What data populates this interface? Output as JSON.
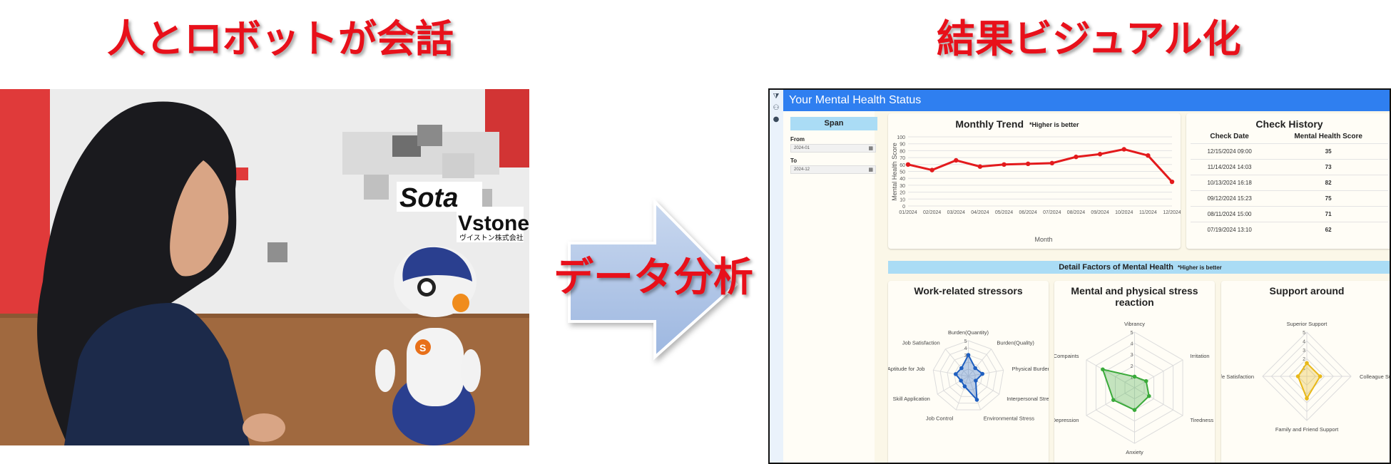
{
  "left_title": "人とロボットが会話",
  "right_title": "結果ビジュアル化",
  "arrow_label": "データ分析",
  "photo": {
    "sota_logo": "Sota",
    "vstone_logo": "Vstone",
    "vstone_sub": "ヴイストン株式会社"
  },
  "app": {
    "title": "Your Mental Health Status",
    "sidebar": {
      "span_label": "Span",
      "from_label": "From",
      "from_value": "2024-01",
      "to_label": "To",
      "to_value": "2024-12"
    },
    "monthly_trend": {
      "title": "Monthly Trend",
      "note": "*Higher is better",
      "ylabel": "Mental Health Score",
      "xlabel": "Month"
    },
    "check_history": {
      "title": "Check History",
      "col_date": "Check Date",
      "col_score": "Mental Health Score",
      "rows": [
        {
          "date": "12/15/2024 09:00",
          "score": "35"
        },
        {
          "date": "11/14/2024 14:03",
          "score": "73"
        },
        {
          "date": "10/13/2024 16:18",
          "score": "82"
        },
        {
          "date": "09/12/2024 15:23",
          "score": "75"
        },
        {
          "date": "08/11/2024 15:00",
          "score": "71"
        },
        {
          "date": "07/19/2024 13:10",
          "score": "62"
        }
      ]
    },
    "detail_title": "Detail Factors of Mental Health",
    "detail_note": "*Higher is better",
    "radar_titles": {
      "work": "Work-related stressors",
      "reaction": "Mental and physical stress reaction",
      "support": "Support around"
    }
  },
  "colors": {
    "title_red": "#e8101a",
    "header_blue": "#2f7ff0",
    "line_red": "#e31a1c",
    "radar_blue": "#1f5fc0",
    "radar_green": "#3aaa3a",
    "radar_yellow": "#e8b818"
  },
  "chart_data": [
    {
      "type": "line",
      "title": "Monthly Trend",
      "xlabel": "Month",
      "ylabel": "Mental Health Score",
      "ylim": [
        0,
        100
      ],
      "yticks": [
        "0",
        "10",
        "20",
        "30",
        "40",
        "50",
        "60",
        "70",
        "80",
        "90",
        "100"
      ],
      "categories": [
        "01/2024",
        "02/2024",
        "03/2024",
        "04/2024",
        "05/2024",
        "06/2024",
        "07/2024",
        "08/2024",
        "09/2024",
        "10/2024",
        "11/2024",
        "12/2024"
      ],
      "values": [
        60,
        52,
        66,
        57,
        60,
        61,
        62,
        71,
        75,
        82,
        73,
        35
      ],
      "grid": true
    },
    {
      "type": "radar",
      "title": "Work-related stressors",
      "axes": [
        "Burden(Quantity)",
        "Burden(Quality)",
        "Physical Burden",
        "Interpersonal Stress",
        "Environmental Stress",
        "Job Control",
        "Skill Application",
        "Aptitude for Job",
        "Job Satisfaction"
      ],
      "values": [
        3,
        1.5,
        2,
        1.2,
        3.5,
        1.5,
        1.2,
        1.8,
        1.5
      ],
      "rmax": 5,
      "ticks": [
        "3",
        "4",
        "5"
      ]
    },
    {
      "type": "radar",
      "title": "Mental and physical stress reaction",
      "axes": [
        "Vibrancy",
        "Irritation",
        "Tiredness",
        "Anxiety",
        "Depression",
        "Compaints"
      ],
      "values": [
        1,
        1.2,
        1.5,
        2,
        2.2,
        3.3
      ],
      "rmax": 5,
      "ticks": [
        "1",
        "2",
        "3",
        "4",
        "5"
      ]
    },
    {
      "type": "radar",
      "title": "Support around",
      "axes": [
        "Superior Support",
        "Colleague Support",
        "Family and Friend Support",
        "Life Satisfaction"
      ],
      "values": [
        1.5,
        1.5,
        2.5,
        1
      ],
      "rmax": 5,
      "ticks": [
        "1",
        "2",
        "3",
        "4",
        "5"
      ]
    }
  ]
}
